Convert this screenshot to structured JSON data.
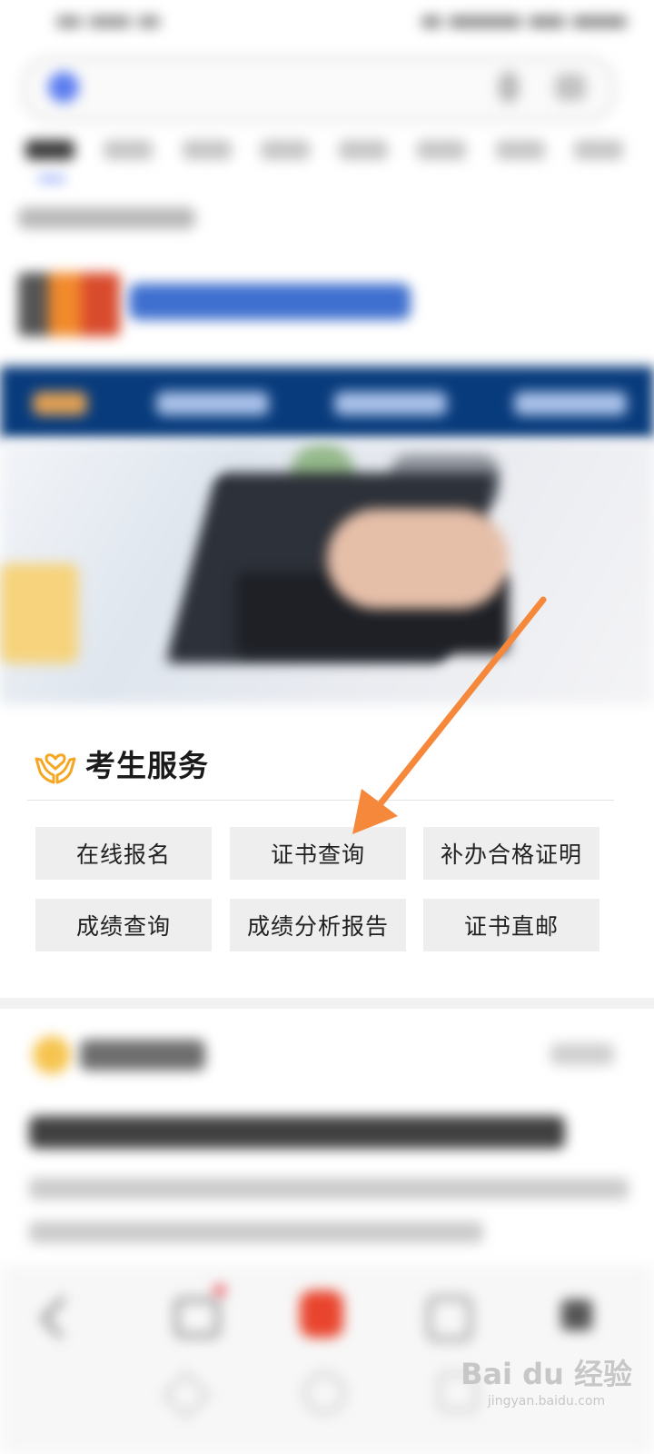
{
  "services": {
    "title": "考生服务",
    "icon": "heart-hands-icon",
    "buttons": [
      {
        "label": "在线报名"
      },
      {
        "label": "证书查询"
      },
      {
        "label": "补办合格证明"
      },
      {
        "label": "成绩查询"
      },
      {
        "label": "成绩分析报告"
      },
      {
        "label": "证书直邮"
      }
    ]
  },
  "annotation": {
    "arrow_color": "#f5883a",
    "points_to": "证书查询"
  },
  "colors": {
    "nav_blue": "#083b7c",
    "button_bg": "#eeeeee",
    "accent_orange": "#f5a623"
  },
  "watermark": {
    "brand": "Bai du 经验",
    "url": "jingyan.baidu.com"
  }
}
